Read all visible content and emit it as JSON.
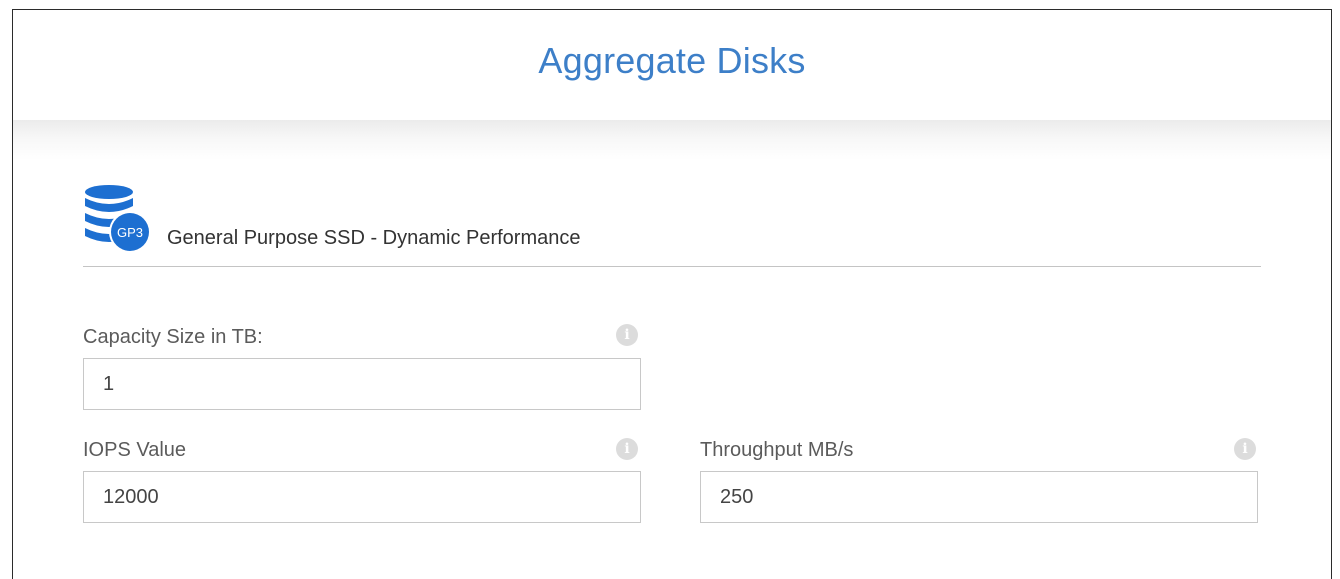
{
  "header": {
    "title": "Aggregate Disks"
  },
  "disk_type": {
    "icon": "database-gp3-icon",
    "badge": "GP3",
    "label": "General Purpose SSD - Dynamic Performance",
    "icon_color": "#1d6fd1"
  },
  "fields": {
    "capacity": {
      "label": "Capacity Size in TB:",
      "value": "1",
      "info_icon": "info-icon"
    },
    "iops": {
      "label": "IOPS Value",
      "value": "12000",
      "info_icon": "info-icon"
    },
    "throughput": {
      "label": "Throughput MB/s",
      "value": "250",
      "info_icon": "info-icon"
    }
  },
  "colors": {
    "title": "#3d7fc8",
    "border": "#c8c8c8"
  }
}
